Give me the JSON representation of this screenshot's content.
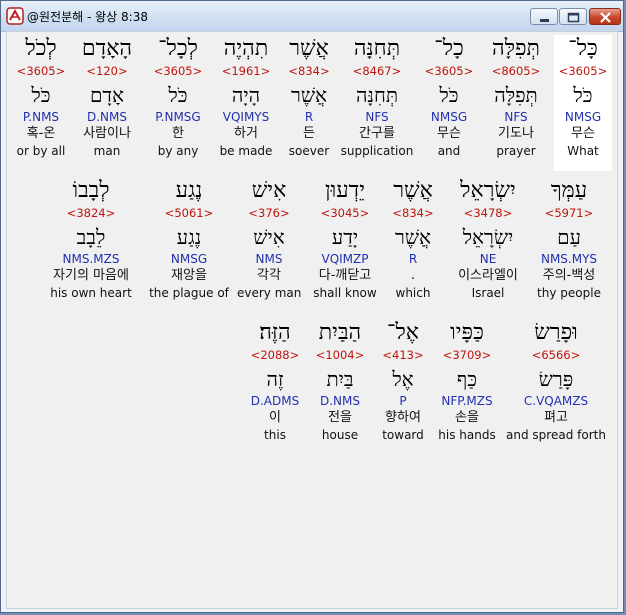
{
  "window": {
    "title": "@원전분해 - 왕상 8:38",
    "icon": "app-book-icon",
    "buttons": [
      "minimize-icon",
      "maximize-icon",
      "close-icon"
    ]
  },
  "rows": [
    {
      "words": [
        {
          "heb": "כָּל־",
          "num": "<3605>",
          "lemma": "כֹּל",
          "morph": "NMSG",
          "kor": "무슨",
          "eng": "What",
          "selected": true
        },
        {
          "heb": "תְּפִלָּה",
          "num": "<8605>",
          "lemma": "תְּפִלָּה",
          "morph": "NFS",
          "kor": "기도나",
          "eng": "prayer",
          "selected": false
        },
        {
          "heb": "כָל־",
          "num": "<3605>",
          "lemma": "כֹּל",
          "morph": "NMSG",
          "kor": "무슨",
          "eng": "and",
          "selected": false
        },
        {
          "heb": "תְּחִנָּה",
          "num": "<8467>",
          "lemma": "תְּחִנָּה",
          "morph": "NFS",
          "kor": "간구를",
          "eng": "supplication",
          "selected": false
        },
        {
          "heb": "אֲשֶׁר",
          "num": "<834>",
          "lemma": "אֲשֶׁר",
          "morph": "R",
          "kor": "든",
          "eng": "soever",
          "selected": false
        },
        {
          "heb": "תִהְיֶה",
          "num": "<1961>",
          "lemma": "הָיָה",
          "morph": "VQIMYS",
          "kor": "하거",
          "eng": "be made",
          "selected": false
        },
        {
          "heb": "לְכָל־",
          "num": "<3605>",
          "lemma": "כֹּל",
          "morph": "P.NMSG",
          "kor": "한",
          "eng": "by any",
          "selected": false
        },
        {
          "heb": "הָאָדָם",
          "num": "<120>",
          "lemma": "אָדָם",
          "morph": "D.NMS",
          "kor": "사람이나",
          "eng": "man",
          "selected": false
        },
        {
          "heb": "לְכֹל",
          "num": "<3605>",
          "lemma": "כֹּל",
          "morph": "P.NMS",
          "kor": "혹-온",
          "eng": "or by all",
          "selected": false
        }
      ]
    },
    {
      "words": [
        {
          "heb": "עַמְּךָ",
          "num": "<5971>",
          "lemma": "עַם",
          "morph": "NMS.MYS",
          "kor": "주의-백성",
          "eng": "thy people",
          "selected": false
        },
        {
          "heb": "יִשְׂרָאֵל",
          "num": "<3478>",
          "lemma": "יִשְׂרָאֵל",
          "morph": "NE",
          "kor": "이스라엘이",
          "eng": "Israel",
          "selected": false
        },
        {
          "heb": "אֲשֶׁר",
          "num": "<834>",
          "lemma": "אֲשֶׁר",
          "morph": "R",
          "kor": ".",
          "eng": "which",
          "selected": false
        },
        {
          "heb": "יֵדְעוּן",
          "num": "<3045>",
          "lemma": "יָדַע",
          "morph": "VQIMZP",
          "kor": "다-깨닫고",
          "eng": "shall know",
          "selected": false
        },
        {
          "heb": "אִישׁ",
          "num": "<376>",
          "lemma": "אִישׁ",
          "morph": "NMS",
          "kor": "각각",
          "eng": "every man",
          "selected": false
        },
        {
          "heb": "נֶגַע",
          "num": "<5061>",
          "lemma": "נֶגַע",
          "morph": "NMSG",
          "kor": "재앙을",
          "eng": "the plague of",
          "selected": false
        },
        {
          "heb": "לְבָבוֹ",
          "num": "<3824>",
          "lemma": "לֵבָב",
          "morph": "NMS.MZS",
          "kor": "자기의 마음에",
          "eng": "his own heart",
          "selected": false
        }
      ]
    },
    {
      "words": [
        {
          "heb": "וּפָרַשׂ",
          "num": "<6566>",
          "lemma": "פָּרַשׂ",
          "morph": "C.VQAMZS",
          "kor": "펴고",
          "eng": "and spread forth",
          "selected": false
        },
        {
          "heb": "כַּפָּיו",
          "num": "<3709>",
          "lemma": "כַּף",
          "morph": "NFP.MZS",
          "kor": "손을",
          "eng": "his hands",
          "selected": false
        },
        {
          "heb": "אֶל־",
          "num": "<413>",
          "lemma": "אֶל",
          "morph": "P",
          "kor": "향하여",
          "eng": "toward",
          "selected": false
        },
        {
          "heb": "הַבַּיִת",
          "num": "<1004>",
          "lemma": "בַּיִת",
          "morph": "D.NMS",
          "kor": "전을",
          "eng": "house",
          "selected": false
        },
        {
          "heb": "הַזֶּה׃",
          "num": "<2088>",
          "lemma": "זֶה",
          "morph": "D.ADMS",
          "kor": "이",
          "eng": "this",
          "selected": false
        }
      ]
    }
  ]
}
